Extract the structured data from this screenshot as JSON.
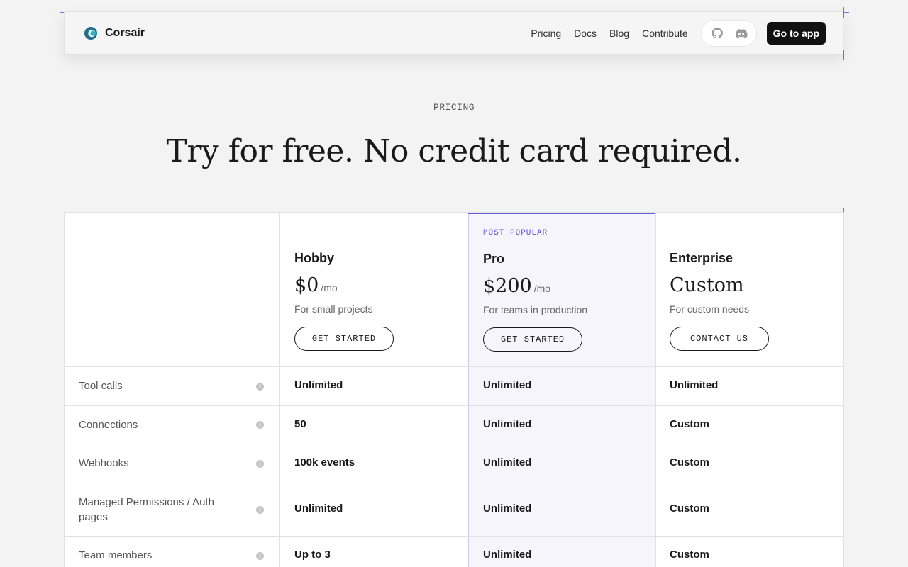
{
  "nav": {
    "brand": "Corsair",
    "links": [
      "Pricing",
      "Docs",
      "Blog",
      "Contribute"
    ],
    "cta": "Go to app",
    "icons": [
      "github-icon",
      "discord-icon"
    ]
  },
  "hero": {
    "eyebrow": "PRICING",
    "headline": "Try for free. No credit card required."
  },
  "plans": [
    {
      "badge": "",
      "name": "Hobby",
      "price": "$0",
      "unit": "/mo",
      "desc": "For small projects",
      "button": "GET STARTED"
    },
    {
      "badge": "MOST POPULAR",
      "name": "Pro",
      "price": "$200",
      "unit": "/mo",
      "desc": "For teams in production",
      "button": "GET STARTED"
    },
    {
      "badge": "",
      "name": "Enterprise",
      "price": "Custom",
      "unit": "",
      "desc": "For custom needs",
      "button": "CONTACT US"
    }
  ],
  "features": [
    {
      "label": "Tool calls",
      "values": [
        "Unlimited",
        "Unlimited",
        "Unlimited"
      ]
    },
    {
      "label": "Connections",
      "values": [
        "50",
        "Unlimited",
        "Custom"
      ]
    },
    {
      "label": "Webhooks",
      "values": [
        "100k events",
        "Unlimited",
        "Custom"
      ]
    },
    {
      "label": "Managed Permissions / Auth pages",
      "values": [
        "Unlimited",
        "Unlimited",
        "Custom"
      ]
    },
    {
      "label": "Team members",
      "values": [
        "Up to 3",
        "Unlimited",
        "Custom"
      ]
    }
  ],
  "colors": {
    "accent": "#6a5fd6",
    "pro_bg": "#f6f5fc",
    "cta_bg": "#111111"
  }
}
